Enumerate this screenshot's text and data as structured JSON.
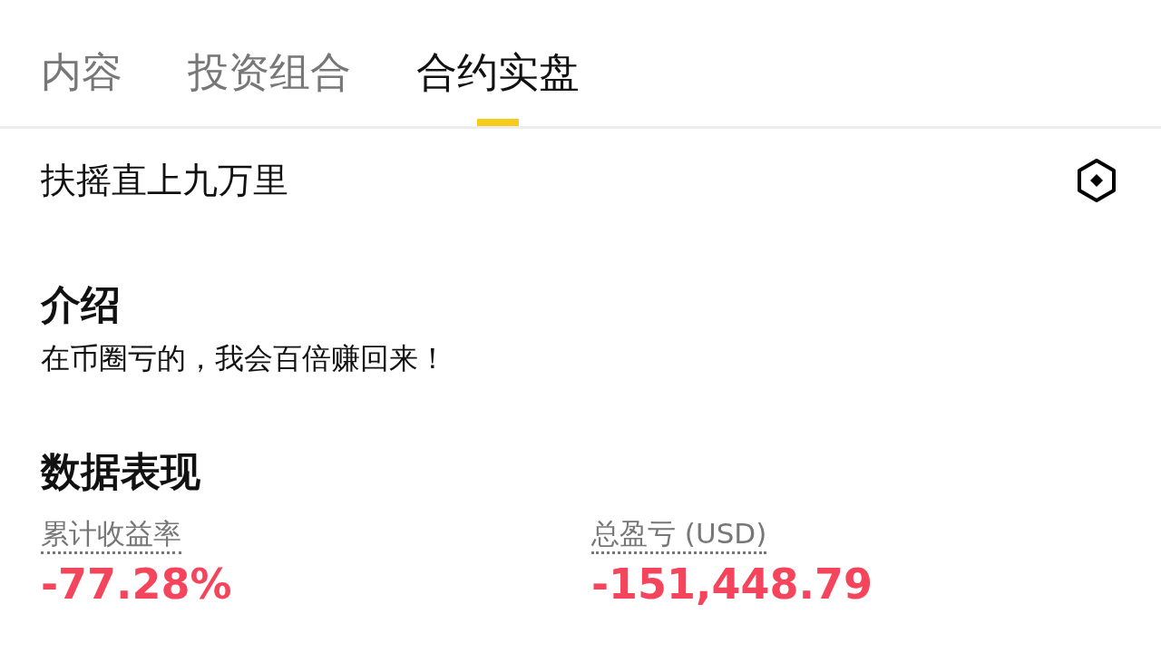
{
  "tabs": [
    {
      "label": "内容",
      "selected": false
    },
    {
      "label": "投资组合",
      "selected": false
    },
    {
      "label": "合约实盘",
      "selected": true
    }
  ],
  "profile": {
    "name": "扶摇直上九万里"
  },
  "intro": {
    "title": "介绍",
    "text": "在币圈亏的，我会百倍赚回来！"
  },
  "performance": {
    "title": "数据表现",
    "stats": [
      {
        "label": "累计收益率",
        "value": "-77.28%"
      },
      {
        "label": "总盈亏 (USD)",
        "value": "-151,448.79"
      }
    ]
  }
}
